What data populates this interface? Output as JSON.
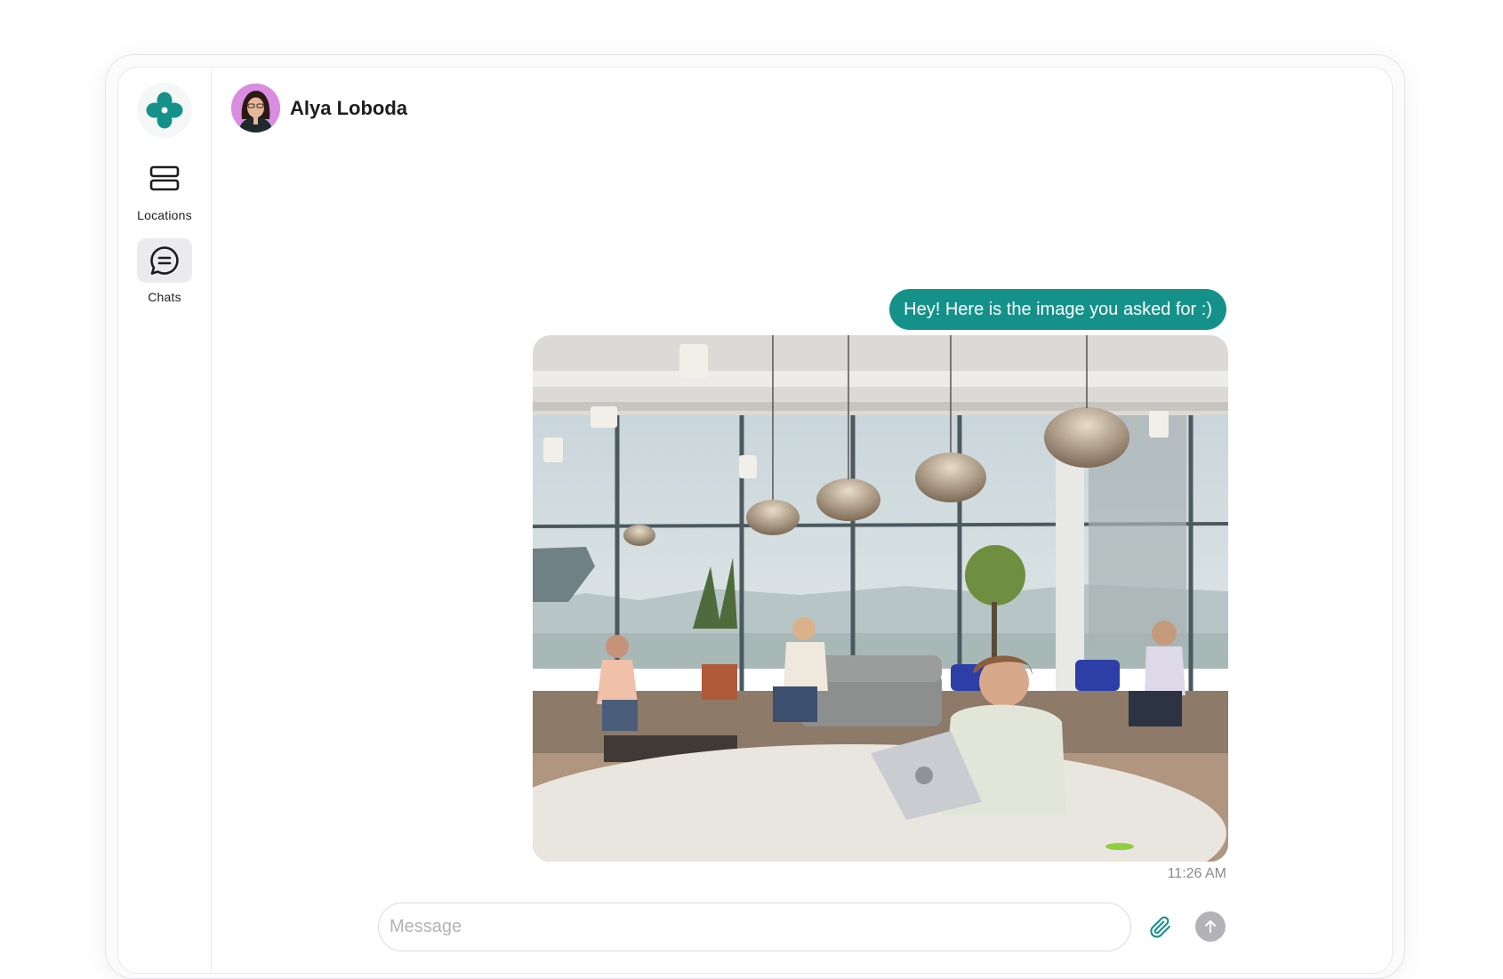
{
  "sidebar": {
    "logo_icon": "clover-logo-icon",
    "items": [
      {
        "label": "Locations",
        "icon": "stacked-rows-icon",
        "active": false
      },
      {
        "label": "Chats",
        "icon": "chat-bubble-icon",
        "active": true
      }
    ]
  },
  "header": {
    "contact_name": "Alya Loboda",
    "avatar_color": "#d98ce0"
  },
  "conversation": {
    "messages": [
      {
        "type": "text",
        "text": "Hey! Here is the image you asked for :)"
      },
      {
        "type": "image",
        "alt": "coworking-lounge-photo"
      }
    ],
    "timestamp": "11:26 AM"
  },
  "composer": {
    "placeholder": "Message",
    "attach_icon": "paperclip-icon",
    "send_icon": "arrow-up-icon"
  },
  "colors": {
    "accent": "#14928a",
    "send_button": "#b3b3b7"
  }
}
